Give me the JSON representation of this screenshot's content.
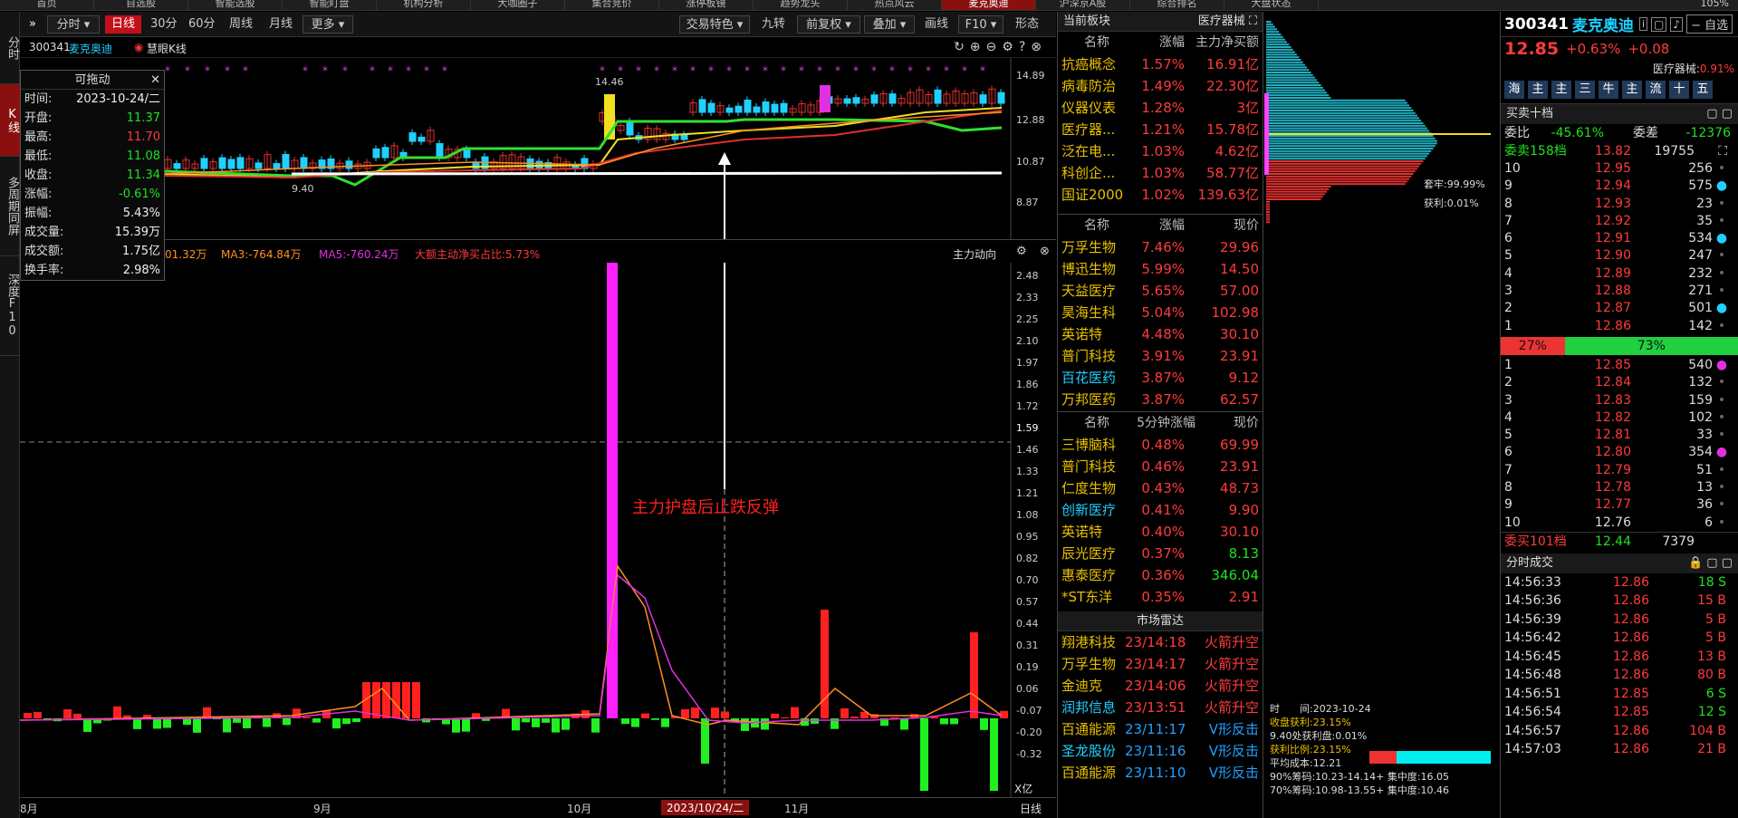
{
  "top_tabs": [
    "首页",
    "自选股",
    "智能选股",
    "智能盯盘",
    "机构分析",
    "大咖圈子",
    "集合竞价",
    "涨停板镜",
    "趋势龙头",
    "热点风云",
    "麦克奥迪",
    "沪深京A股",
    "综合排名",
    "大盘状态"
  ],
  "top_right": "105%",
  "left_tabs": [
    "分时",
    "K线",
    "多周期同屏",
    "深度F10"
  ],
  "toolbar": {
    "left": [
      "分时",
      "日线",
      "30分",
      "60分",
      "周线",
      "月线",
      "更多"
    ],
    "right": [
      "交易特色",
      "九转",
      "前复权",
      "叠加",
      "画线",
      "F10",
      "形态"
    ]
  },
  "kheader": {
    "code": "300341",
    "name": "麦克奥迪",
    "indicator": "慧眼K线"
  },
  "kaxis": [
    "14.89",
    "12.88",
    "10.87",
    "8.87"
  ],
  "kannot": {
    "high_label": "14.46",
    "low_label": "9.40"
  },
  "float_box": {
    "title": "可拖动",
    "rows": [
      {
        "k": "时间:",
        "v": "2023-10-24/二",
        "c": "white"
      },
      {
        "k": "开盘:",
        "v": "11.37",
        "c": "green"
      },
      {
        "k": "最高:",
        "v": "11.70",
        "c": "red"
      },
      {
        "k": "最低:",
        "v": "11.08",
        "c": "green"
      },
      {
        "k": "收盘:",
        "v": "11.34",
        "c": "green"
      },
      {
        "k": "涨幅:",
        "v": "-0.61%",
        "c": "green"
      },
      {
        "k": "振幅:",
        "v": "5.43%",
        "c": "white"
      },
      {
        "k": "成交量:",
        "v": "15.39万",
        "c": "white"
      },
      {
        "k": "成交额:",
        "v": "1.75亿",
        "c": "white"
      },
      {
        "k": "换手率:",
        "v": "2.98%",
        "c": "white"
      }
    ]
  },
  "ind_header": {
    "t0": "01.32万",
    "t1": "MA3:-764.84万",
    "t2": "MA5:-760.24万",
    "t3": "大额主动净买占比:5.73%",
    "right": "主力动向"
  },
  "iaxis": [
    "2.48",
    "2.33",
    "2.25",
    "2.10",
    "1.97",
    "1.86",
    "1.72",
    "1.59",
    "1.46",
    "1.33",
    "1.21",
    "1.08",
    "0.95",
    "0.82",
    "0.70",
    "0.57",
    "0.44",
    "0.31",
    "0.19",
    "0.06",
    "-0.07",
    "-0.20",
    "-0.32"
  ],
  "iaxis_unit": "X亿",
  "annotation": "主力护盘后止跌反弹",
  "xaxis": {
    "labels": [
      "8月",
      "9月",
      "10月",
      "11月"
    ],
    "cursor": "2023/10/24/二",
    "period": "日线"
  },
  "sector": {
    "header": "当前板块",
    "header_right": "医疗器械",
    "cols1": [
      "名称",
      "涨幅",
      "主力净买额"
    ],
    "rows1": [
      [
        "抗癌概念",
        "1.57%",
        "16.91亿"
      ],
      [
        "病毒防治",
        "1.49%",
        "22.30亿"
      ],
      [
        "仪器仪表",
        "1.28%",
        "3亿"
      ],
      [
        "医疗器...",
        "1.21%",
        "15.78亿"
      ],
      [
        "泛在电...",
        "1.03%",
        "4.62亿"
      ],
      [
        "科创企...",
        "1.03%",
        "58.77亿"
      ],
      [
        "国证2000",
        "1.02%",
        "139.63亿"
      ]
    ],
    "cols2": [
      "名称",
      "涨幅",
      "现价"
    ],
    "rows2": [
      [
        "万孚生物",
        "7.46%",
        "29.96"
      ],
      [
        "博迅生物",
        "5.99%",
        "14.50"
      ],
      [
        "天益医疗",
        "5.65%",
        "57.00"
      ],
      [
        "昊海生科",
        "5.04%",
        "102.98"
      ],
      [
        "英诺特",
        "4.48%",
        "30.10"
      ],
      [
        "普门科技",
        "3.91%",
        "23.91"
      ],
      [
        "百花医药",
        "3.87%",
        "9.12"
      ],
      [
        "万邦医药",
        "3.87%",
        "62.57"
      ]
    ],
    "cols3": [
      "名称",
      "5分钟涨幅",
      "现价"
    ],
    "rows3": [
      [
        "三博脑科",
        "0.48%",
        "69.99"
      ],
      [
        "普门科技",
        "0.46%",
        "23.91"
      ],
      [
        "仁度生物",
        "0.43%",
        "48.73"
      ],
      [
        "创新医疗",
        "0.41%",
        "9.90"
      ],
      [
        "英诺特",
        "0.40%",
        "30.10"
      ],
      [
        "辰光医疗",
        "0.37%",
        "8.13"
      ],
      [
        "惠泰医疗",
        "0.36%",
        "346.04"
      ],
      [
        "*ST东洋",
        "0.35%",
        "2.91"
      ]
    ],
    "radar_title": "市场雷达",
    "radar": [
      [
        "翔港科技",
        "23/14:18",
        "火箭升空"
      ],
      [
        "万孚生物",
        "23/14:17",
        "火箭升空"
      ],
      [
        "金迪克",
        "23/14:06",
        "火箭升空"
      ],
      [
        "润邦信息",
        "23/13:51",
        "火箭升空"
      ],
      [
        "百通能源",
        "23/11:17",
        "V形反击"
      ],
      [
        "圣龙股份",
        "23/11:16",
        "V形反击"
      ],
      [
        "百通能源",
        "23/11:10",
        "V形反击"
      ]
    ]
  },
  "depth": {
    "profit_rate": "套牢:99.99%",
    "gain": "获利:0.01%",
    "lines": [
      "时　　间:2023-10-24",
      "收盘获利:23.15%",
      "9.40处获利盘:0.01%",
      "获利比例:23.15%",
      "平均成本:12.21",
      "90%筹码:10.23-14.14+ 集中度:16.05",
      "70%筹码:10.98-13.55+ 集中度:10.46"
    ]
  },
  "quote": {
    "code": "300341",
    "name": "麦克奥迪",
    "fav": "自选",
    "price": "12.85",
    "pct": "+0.63%",
    "chg": "+0.08",
    "sector_label": "医疗器械:",
    "sector_pct": "0.91%",
    "buttons": [
      "海",
      "主",
      "主",
      "三",
      "牛",
      "主",
      "流",
      "十",
      "五"
    ],
    "book_title": "买卖十档",
    "wb_label": "委比",
    "wb": "-45.61%",
    "wc_label": "委差",
    "wc": "-12376",
    "sell_total_label": "委卖158档",
    "sell_total_price": "13.82",
    "sell_total_vol": "19755",
    "sells": [
      [
        "10",
        "12.95",
        "256",
        ""
      ],
      [
        "9",
        "12.94",
        "575",
        "c"
      ],
      [
        "8",
        "12.93",
        "23",
        ""
      ],
      [
        "7",
        "12.92",
        "35",
        ""
      ],
      [
        "6",
        "12.91",
        "534",
        "c"
      ],
      [
        "5",
        "12.90",
        "247",
        ""
      ],
      [
        "4",
        "12.89",
        "232",
        ""
      ],
      [
        "3",
        "12.88",
        "271",
        ""
      ],
      [
        "2",
        "12.87",
        "501",
        "c"
      ],
      [
        "1",
        "12.86",
        "142",
        ""
      ]
    ],
    "ratio_left": "27%",
    "ratio_right": "73%",
    "buys": [
      [
        "1",
        "12.85",
        "540",
        "m"
      ],
      [
        "2",
        "12.84",
        "132",
        ""
      ],
      [
        "3",
        "12.83",
        "159",
        ""
      ],
      [
        "4",
        "12.82",
        "102",
        ""
      ],
      [
        "5",
        "12.81",
        "33",
        ""
      ],
      [
        "6",
        "12.80",
        "354",
        "m"
      ],
      [
        "7",
        "12.79",
        "51",
        ""
      ],
      [
        "8",
        "12.78",
        "13",
        ""
      ],
      [
        "9",
        "12.77",
        "36",
        ""
      ],
      [
        "10",
        "12.76",
        "6",
        ""
      ]
    ],
    "buy_total_label": "委买101档",
    "buy_total_price": "12.44",
    "buy_total_vol": "7379",
    "ticks_title": "分时成交",
    "ticks": [
      [
        "14:56:33",
        "12.86",
        "18 S"
      ],
      [
        "14:56:36",
        "12.86",
        "15 B"
      ],
      [
        "14:56:39",
        "12.86",
        "5 B"
      ],
      [
        "14:56:42",
        "12.86",
        "5 B"
      ],
      [
        "14:56:45",
        "12.86",
        "13 B"
      ],
      [
        "14:56:48",
        "12.86",
        "80 B"
      ],
      [
        "14:56:51",
        "12.85",
        "6 S"
      ],
      [
        "14:56:54",
        "12.85",
        "12 S"
      ],
      [
        "14:56:57",
        "12.86",
        "104 B"
      ],
      [
        "14:57:03",
        "12.86",
        "21 B"
      ]
    ]
  }
}
